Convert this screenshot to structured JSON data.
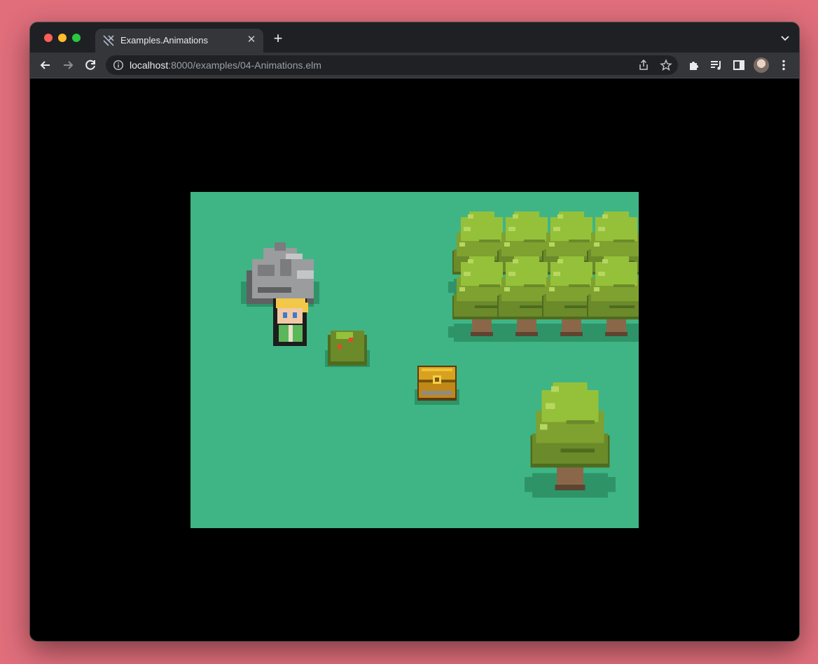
{
  "browser": {
    "tab": {
      "title": "Examples.Animations",
      "favicon": "elm-tangram-icon"
    },
    "url": {
      "host": "localhost",
      "rest": ":8000/examples/04-Animations.elm"
    },
    "controls": {
      "back": "back-arrow-icon",
      "forward": "forward-arrow-icon",
      "reload": "reload-icon",
      "info": "info-icon",
      "share": "share-icon",
      "bookmark": "star-icon",
      "extensions": "puzzle-icon",
      "media": "media-queue-icon",
      "sidepanel": "side-panel-icon",
      "profile": "avatar",
      "menu": "kebab-menu-icon"
    }
  },
  "colors": {
    "page_bg": "#e06e7b",
    "grass": "#3fb585",
    "shadow": "#2e9468",
    "tree_light": "#95c13a",
    "tree_dark": "#6b8a2a",
    "trunk": "#8b6749",
    "rock": "#9a9c9e",
    "chest": "#d8a21f"
  },
  "scene": {
    "objects": [
      "rock",
      "player",
      "bush",
      "treasure-chest",
      "tree-cluster",
      "single-tree"
    ]
  }
}
